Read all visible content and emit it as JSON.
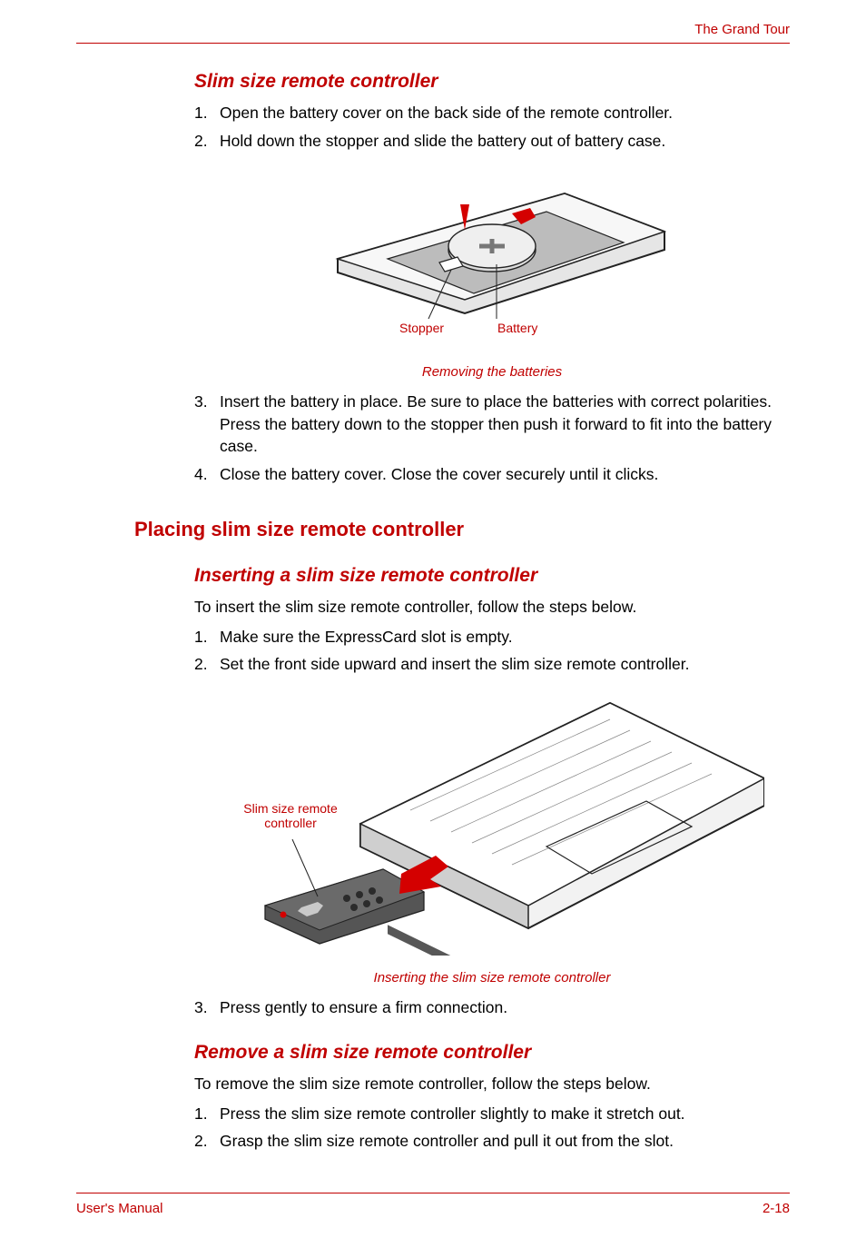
{
  "header": {
    "chapter_title": "The Grand Tour"
  },
  "section1": {
    "heading": "Slim size remote controller",
    "steps_a": [
      "Open the battery cover on the back side of the remote controller.",
      "Hold down the stopper and slide the battery out of battery case."
    ],
    "fig1": {
      "callout_stopper": "Stopper",
      "callout_battery": "Battery",
      "caption": "Removing the batteries"
    },
    "steps_b_start": 3,
    "steps_b": [
      "Insert the battery in place. Be sure to place the batteries with correct polarities. Press the battery down to the stopper then push it forward to fit into the battery case.",
      "Close the battery cover. Close the cover securely until it clicks."
    ]
  },
  "section2": {
    "heading": "Placing slim size remote controller",
    "sub1": {
      "heading": "Inserting a slim size remote controller",
      "intro": "To insert the slim size remote controller, follow the steps below.",
      "steps_a": [
        "Make sure the ExpressCard slot is empty.",
        "Set the front side upward and insert the slim size remote controller."
      ],
      "fig2": {
        "callout_remote": "Slim size remote controller",
        "caption": "Inserting the slim size remote controller"
      },
      "steps_b_start": 3,
      "steps_b": [
        "Press gently to ensure a firm connection."
      ]
    },
    "sub2": {
      "heading": "Remove a slim size remote controller",
      "intro": "To remove the slim size remote controller, follow the steps below.",
      "steps": [
        "Press the slim size remote controller slightly to make it stretch out.",
        "Grasp the slim size remote controller and pull it out from the slot."
      ]
    }
  },
  "footer": {
    "left": "User's Manual",
    "right": "2-18"
  }
}
